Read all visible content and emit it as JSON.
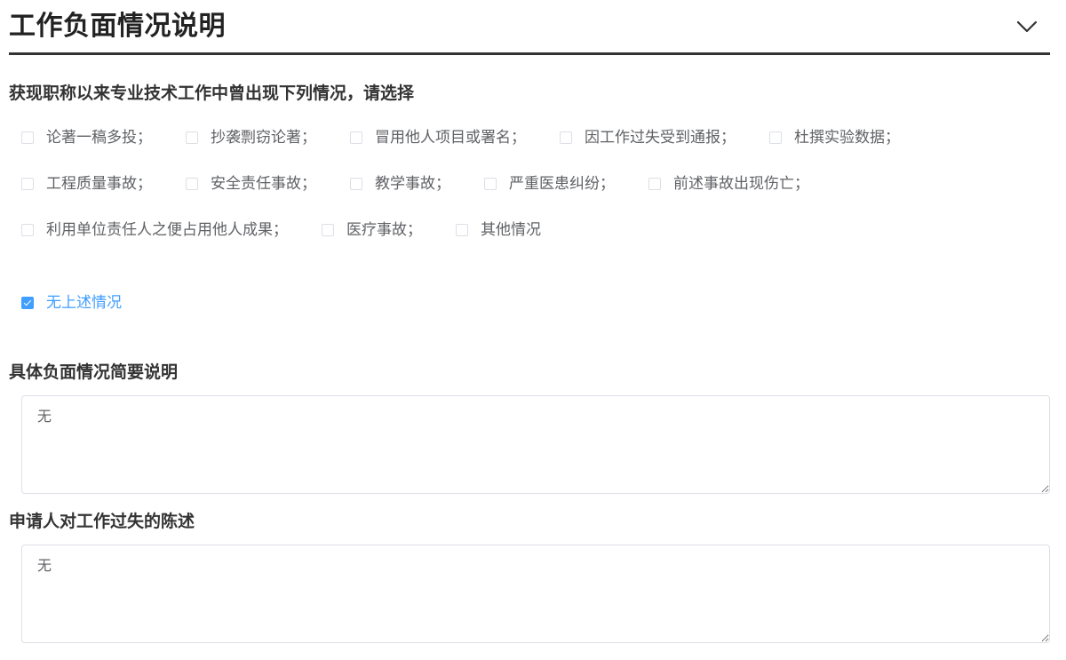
{
  "section": {
    "title": "工作负面情况说明",
    "toggle_icon": "chevron-down-icon"
  },
  "question": {
    "label": "获现职称以来专业技术工作中曾出现下列情况，请选择",
    "rows": [
      [
        {
          "label": "论著一稿多投；",
          "checked": false
        },
        {
          "label": "抄袭剽窃论著；",
          "checked": false
        },
        {
          "label": "冒用他人项目或署名；",
          "checked": false
        },
        {
          "label": "因工作过失受到通报；",
          "checked": false
        },
        {
          "label": "杜撰实验数据；",
          "checked": false
        }
      ],
      [
        {
          "label": "工程质量事故；",
          "checked": false
        },
        {
          "label": "安全责任事故；",
          "checked": false
        },
        {
          "label": "教学事故；",
          "checked": false
        },
        {
          "label": "严重医患纠纷；",
          "checked": false
        },
        {
          "label": "前述事故出现伤亡；",
          "checked": false
        }
      ],
      [
        {
          "label": "利用单位责任人之便占用他人成果；",
          "checked": false
        },
        {
          "label": "医疗事故；",
          "checked": false
        },
        {
          "label": "其他情况",
          "checked": false
        }
      ]
    ],
    "none_option": {
      "label": "无上述情况",
      "checked": true
    }
  },
  "summary": {
    "label": "具体负面情况简要说明",
    "value": "无"
  },
  "statement": {
    "label": "申请人对工作过失的陈述",
    "value": "无"
  },
  "colors": {
    "accent": "#409eff",
    "text": "#333333",
    "option_text": "#606266",
    "border": "#dcdfe6"
  }
}
